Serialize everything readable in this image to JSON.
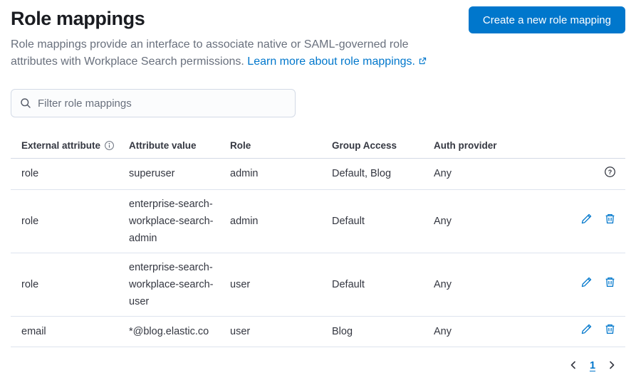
{
  "header": {
    "title": "Role mappings",
    "description": "Role mappings provide an interface to associate native or SAML-governed role attributes with Workplace Search permissions.",
    "learn_more_label": "Learn more about role mappings.",
    "create_button_label": "Create a new role mapping"
  },
  "filter": {
    "placeholder": "Filter role mappings"
  },
  "table": {
    "headers": [
      "External attribute",
      "Attribute value",
      "Role",
      "Group Access",
      "Auth provider"
    ],
    "rows": [
      {
        "external_attribute": "role",
        "attribute_value": "superuser",
        "role": "admin",
        "group_access": "Default, Blog",
        "auth_provider": "Any",
        "actions": [
          "help"
        ]
      },
      {
        "external_attribute": "role",
        "attribute_value": "enterprise-search-workplace-search-admin",
        "role": "admin",
        "group_access": "Default",
        "auth_provider": "Any",
        "actions": [
          "edit",
          "delete"
        ]
      },
      {
        "external_attribute": "role",
        "attribute_value": "enterprise-search-workplace-search-user",
        "role": "user",
        "group_access": "Default",
        "auth_provider": "Any",
        "actions": [
          "edit",
          "delete"
        ]
      },
      {
        "external_attribute": "email",
        "attribute_value": "*@blog.elastic.co",
        "role": "user",
        "group_access": "Blog",
        "auth_provider": "Any",
        "actions": [
          "edit",
          "delete"
        ]
      }
    ]
  },
  "pagination": {
    "current_page": "1"
  },
  "icons": {
    "search": "magnifier",
    "info": "circled-i",
    "help": "circled-question-mark",
    "edit": "pencil",
    "delete": "trash-can",
    "external_link": "box-with-arrow",
    "prev": "chevron-left",
    "next": "chevron-right"
  },
  "colors": {
    "accent_blue": "#0077CC",
    "title_text": "#1A1C21",
    "body_text": "#343741",
    "muted_text": "#69707D",
    "border": "#D3DAE6"
  }
}
